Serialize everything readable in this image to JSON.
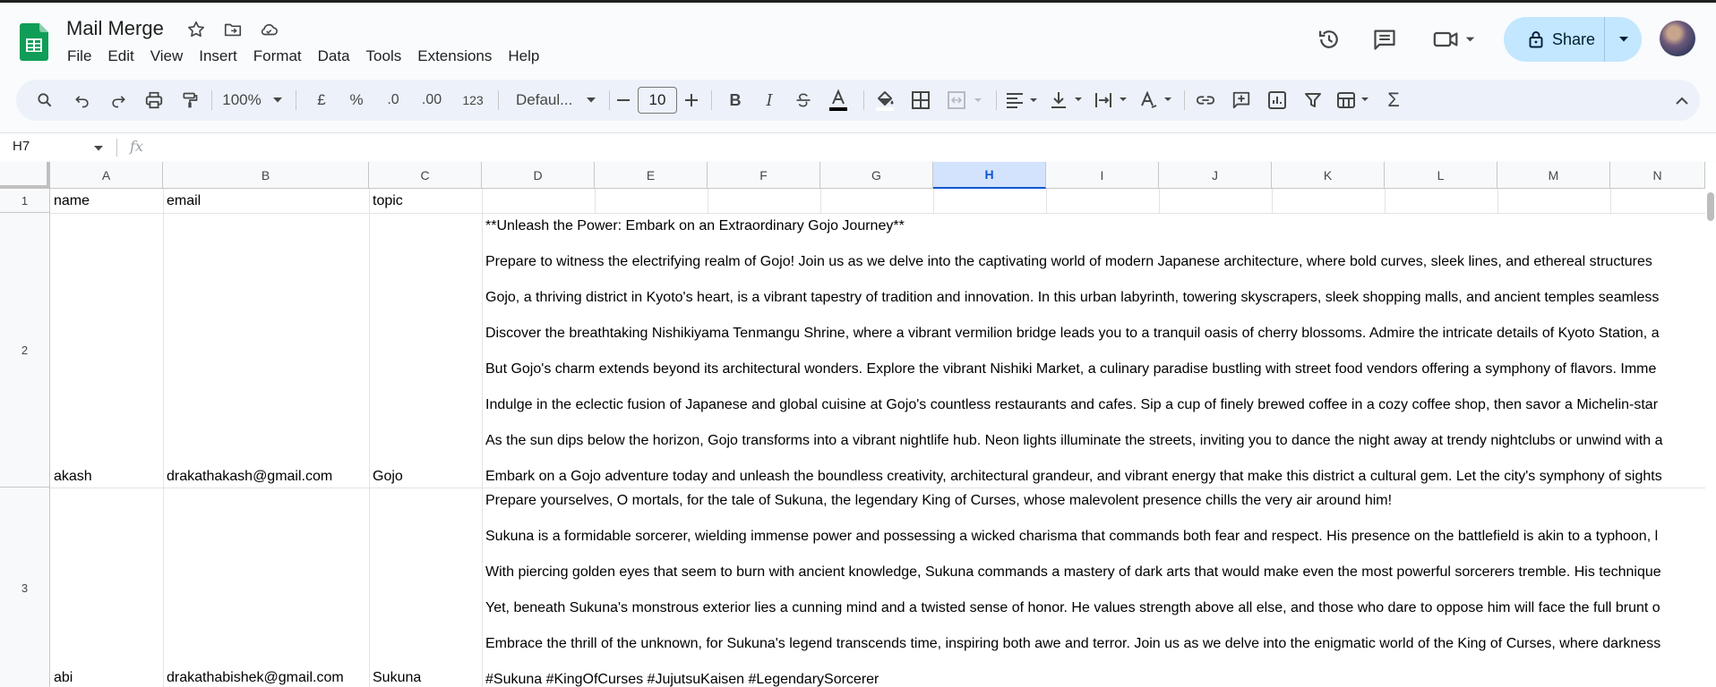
{
  "app": {
    "title": "Mail Merge",
    "menu": [
      "File",
      "Edit",
      "View",
      "Insert",
      "Format",
      "Data",
      "Tools",
      "Extensions",
      "Help"
    ],
    "share_label": "Share"
  },
  "toolbar": {
    "zoom": "100%",
    "currency": "£",
    "percent": "%",
    "decrease_decimal": ".0",
    "increase_decimal": ".00",
    "number_format": "123",
    "font": "Defaul...",
    "font_size": "10"
  },
  "formula_bar": {
    "name_box": "H7",
    "fx_label": "fx"
  },
  "grid": {
    "columns": [
      "A",
      "B",
      "C",
      "D",
      "E",
      "F",
      "G",
      "H",
      "I",
      "J",
      "K",
      "L",
      "M",
      "N"
    ],
    "selected_column": "H",
    "rows": [
      "1",
      "2",
      "3"
    ],
    "header_row": {
      "a": "name",
      "b": "email",
      "c": "topic"
    },
    "row2": {
      "a": "akash",
      "b": "drakathakash@gmail.com",
      "c": "Gojo",
      "d_lines": [
        "**Unleash the Power: Embark on an Extraordinary Gojo Journey**",
        "Prepare to witness the electrifying realm of Gojo! Join us as we delve into the captivating world of modern Japanese architecture, where bold curves, sleek lines, and ethereal structures",
        "Gojo, a thriving district in Kyoto's heart, is a vibrant tapestry of tradition and innovation. In this urban labyrinth, towering skyscrapers, sleek shopping malls, and ancient temples seamless",
        "Discover the breathtaking Nishikiyama Tenmangu Shrine, where a vibrant vermilion bridge leads you to a tranquil oasis of cherry blossoms. Admire the intricate details of Kyoto Station, a",
        "But Gojo's charm extends beyond its architectural wonders. Explore the vibrant Nishiki Market, a culinary paradise bustling with street food vendors offering a symphony of flavors. Imme",
        "Indulge in the eclectic fusion of Japanese and global cuisine at Gojo's countless restaurants and cafes. Sip a cup of finely brewed coffee in a cozy coffee shop, then savor a Michelin-star",
        "As the sun dips below the horizon, Gojo transforms into a vibrant nightlife hub. Neon lights illuminate the streets, inviting you to dance the night away at trendy nightclubs or unwind with a",
        "Embark on a Gojo adventure today and unleash the boundless creativity, architectural grandeur, and vibrant energy that make this district a cultural gem. Let the city's symphony of sights"
      ]
    },
    "row3": {
      "a": "abi",
      "b": "drakathabishek@gmail.com",
      "c": "Sukuna",
      "d_lines": [
        "Prepare yourselves, O mortals, for the tale of Sukuna, the legendary King of Curses, whose malevolent presence chills the very air around him!",
        "Sukuna is a formidable sorcerer, wielding immense power and possessing a wicked charisma that commands both fear and respect. His presence on the battlefield is akin to a typhoon, l",
        "With piercing golden eyes that seem to burn with ancient knowledge, Sukuna commands a mastery of dark arts that would make even the most powerful sorcerers tremble. His technique",
        "Yet, beneath Sukuna's monstrous exterior lies a cunning mind and a twisted sense of honor. He values strength above all else, and those who dare to oppose him will face the full brunt o",
        "Embrace the thrill of the unknown, for Sukuna's legend transcends time, inspiring both awe and terror. Join us as we delve into the enigmatic world of the King of Curses, where darkness",
        "#Sukuna #KingOfCurses #JujutsuKaisen #LegendarySorcerer"
      ]
    }
  }
}
